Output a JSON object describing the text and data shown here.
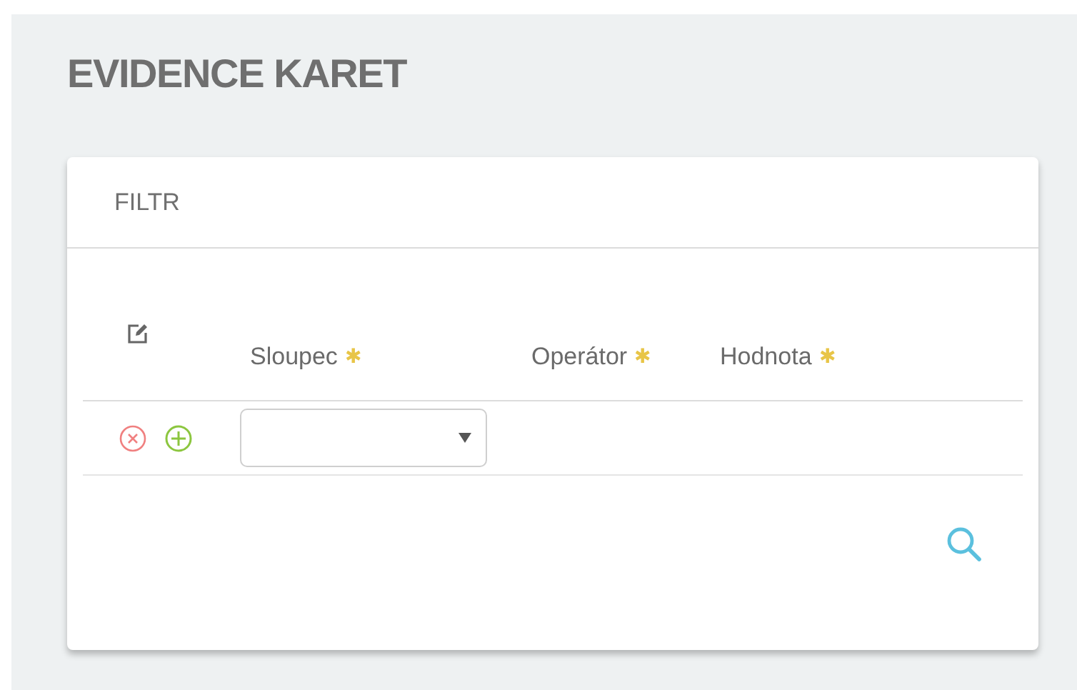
{
  "page": {
    "title": "EVIDENCE KARET"
  },
  "filter": {
    "title": "FILTR",
    "columns": [
      {
        "label": "Sloupec",
        "mark": "✱"
      },
      {
        "label": "Operátor",
        "mark": "✱"
      },
      {
        "label": "Hodnota",
        "mark": "✱"
      }
    ]
  }
}
